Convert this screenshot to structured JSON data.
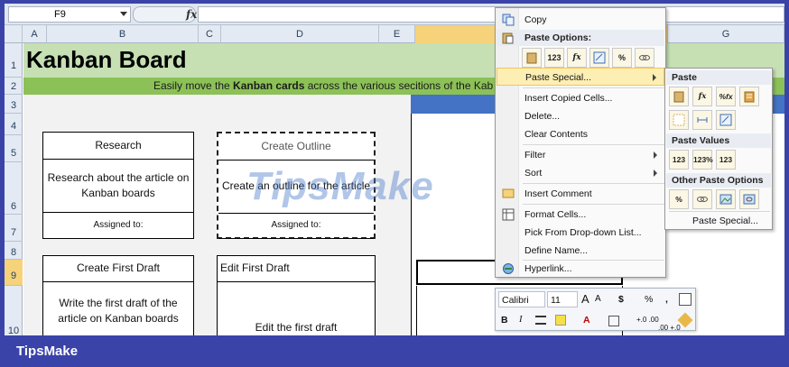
{
  "formula_bar": {
    "name_box": "F9",
    "fx_label": "fx",
    "formula": ""
  },
  "columns": [
    "A",
    "B",
    "C",
    "D",
    "E",
    "",
    "G"
  ],
  "rows": [
    "1",
    "2",
    "3",
    "4",
    "5",
    "6",
    "7",
    "8",
    "9",
    "10"
  ],
  "sheet": {
    "title": "Kanban Board",
    "subtitle_pre": "Easily move the ",
    "subtitle_bold": "Kanban cards",
    "subtitle_post": " across the various secitions of the Kab",
    "watermark": "TipsMake"
  },
  "cards": [
    {
      "title": "Research",
      "body": "Research about the article on Kanban boards",
      "footer": "Assigned to:"
    },
    {
      "title": "Create Outline",
      "body": "Create an outline for the article",
      "footer": "Assigned to:"
    },
    {
      "title": "Create First Draft",
      "body": "Write the first draft of the article on Kanban boards"
    },
    {
      "title": "Edit First Draft",
      "body": "Edit the first draft"
    }
  ],
  "context_menu": {
    "copy": "Copy",
    "paste_options": "Paste Options:",
    "paste_special": "Paste Special...",
    "insert_copied_cells": "Insert Copied Cells...",
    "delete": "Delete...",
    "clear_contents": "Clear Contents",
    "filter": "Filter",
    "sort": "Sort",
    "insert_comment": "Insert Comment",
    "format_cells": "Format Cells...",
    "pick_dropdown": "Pick From Drop-down List...",
    "define_name": "Define Name...",
    "hyperlink": "Hyperlink...",
    "paste_buttons": [
      "",
      "123",
      "fx",
      "",
      "%",
      ""
    ]
  },
  "paste_submenu": {
    "paste_header": "Paste",
    "paste_buttons": [
      "",
      "fx",
      "%fx",
      "",
      "",
      "",
      ""
    ],
    "values_header": "Paste Values",
    "values_buttons": [
      "123",
      "123%",
      "123"
    ],
    "other_header": "Other Paste Options",
    "other_buttons": [
      "%",
      "",
      "",
      ""
    ],
    "paste_special": "Paste Special..."
  },
  "mini_toolbar": {
    "font": "Calibri",
    "size": "11",
    "grow": "A",
    "shrink": "A",
    "currency": "$",
    "percent": "%",
    "comma": ",",
    "bold": "B",
    "italic": "I",
    "font_color": "A",
    "inc_decimal": "+.0 .00",
    "dec_decimal": ".00 +.0"
  },
  "footer": {
    "brand": "TipsMake"
  },
  "colors": {
    "title_band": "#c6e0b4",
    "subtitle_band": "#8cc157",
    "blue_strip": "#4472c4",
    "menu_highlight": "#fdeeb4",
    "frame": "#3a43a8"
  }
}
